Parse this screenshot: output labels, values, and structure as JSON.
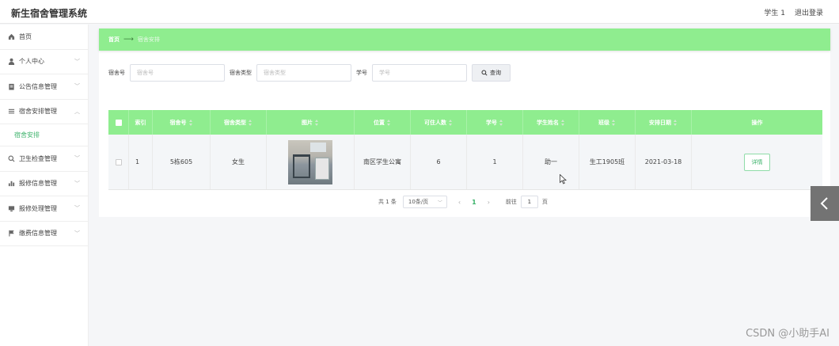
{
  "app": {
    "title": "新生宿舍管理系统"
  },
  "user": {
    "name": "学生 1",
    "logout": "退出登录"
  },
  "sidebar": {
    "items": [
      {
        "label": "首页",
        "icon": "home-icon"
      },
      {
        "label": "个人中心",
        "icon": "user-icon",
        "expandable": true
      },
      {
        "label": "公告信息管理",
        "icon": "notice-icon",
        "expandable": true
      },
      {
        "label": "宿舍安排管理",
        "icon": "list-icon",
        "expandable": true,
        "expanded": true
      },
      {
        "label": "卫生检查管理",
        "icon": "inspect-icon",
        "expandable": true
      },
      {
        "label": "报修信息管理",
        "icon": "chart-icon",
        "expandable": true
      },
      {
        "label": "报修处理管理",
        "icon": "monitor-icon",
        "expandable": true
      },
      {
        "label": "缴费信息管理",
        "icon": "flag-icon",
        "expandable": true
      }
    ],
    "submenu": {
      "label": "宿舍安排"
    }
  },
  "breadcrumb": {
    "home": "首页",
    "current": "宿舍安排"
  },
  "search": {
    "fields": [
      {
        "label": "宿舍号",
        "placeholder": "宿舍号"
      },
      {
        "label": "宿舍类型",
        "placeholder": "宿舍类型"
      },
      {
        "label": "学号",
        "placeholder": "学号"
      }
    ],
    "button": "查询"
  },
  "table": {
    "columns": [
      "索引",
      "宿舍号",
      "宿舍类型",
      "图片",
      "位置",
      "可住人数",
      "学号",
      "学生姓名",
      "班级",
      "安排日期",
      "操作"
    ],
    "rows": [
      {
        "index": "1",
        "room": "5栋605",
        "type": "女生",
        "location": "南区学生公寓",
        "capacity": "6",
        "student_id": "1",
        "student_name": "助一",
        "class": "生工1905班",
        "date": "2021-03-18",
        "action": "详情"
      }
    ]
  },
  "pagination": {
    "total": "共 1 条",
    "page_size": "10条/页",
    "current": "1",
    "goto_label": "前往",
    "goto_value": "1",
    "page_suffix": "页"
  },
  "watermark": "CSDN @小助手AI",
  "colors": {
    "accent": "#8fed8f",
    "link": "#3bb26a",
    "float_tab": "#737373"
  }
}
